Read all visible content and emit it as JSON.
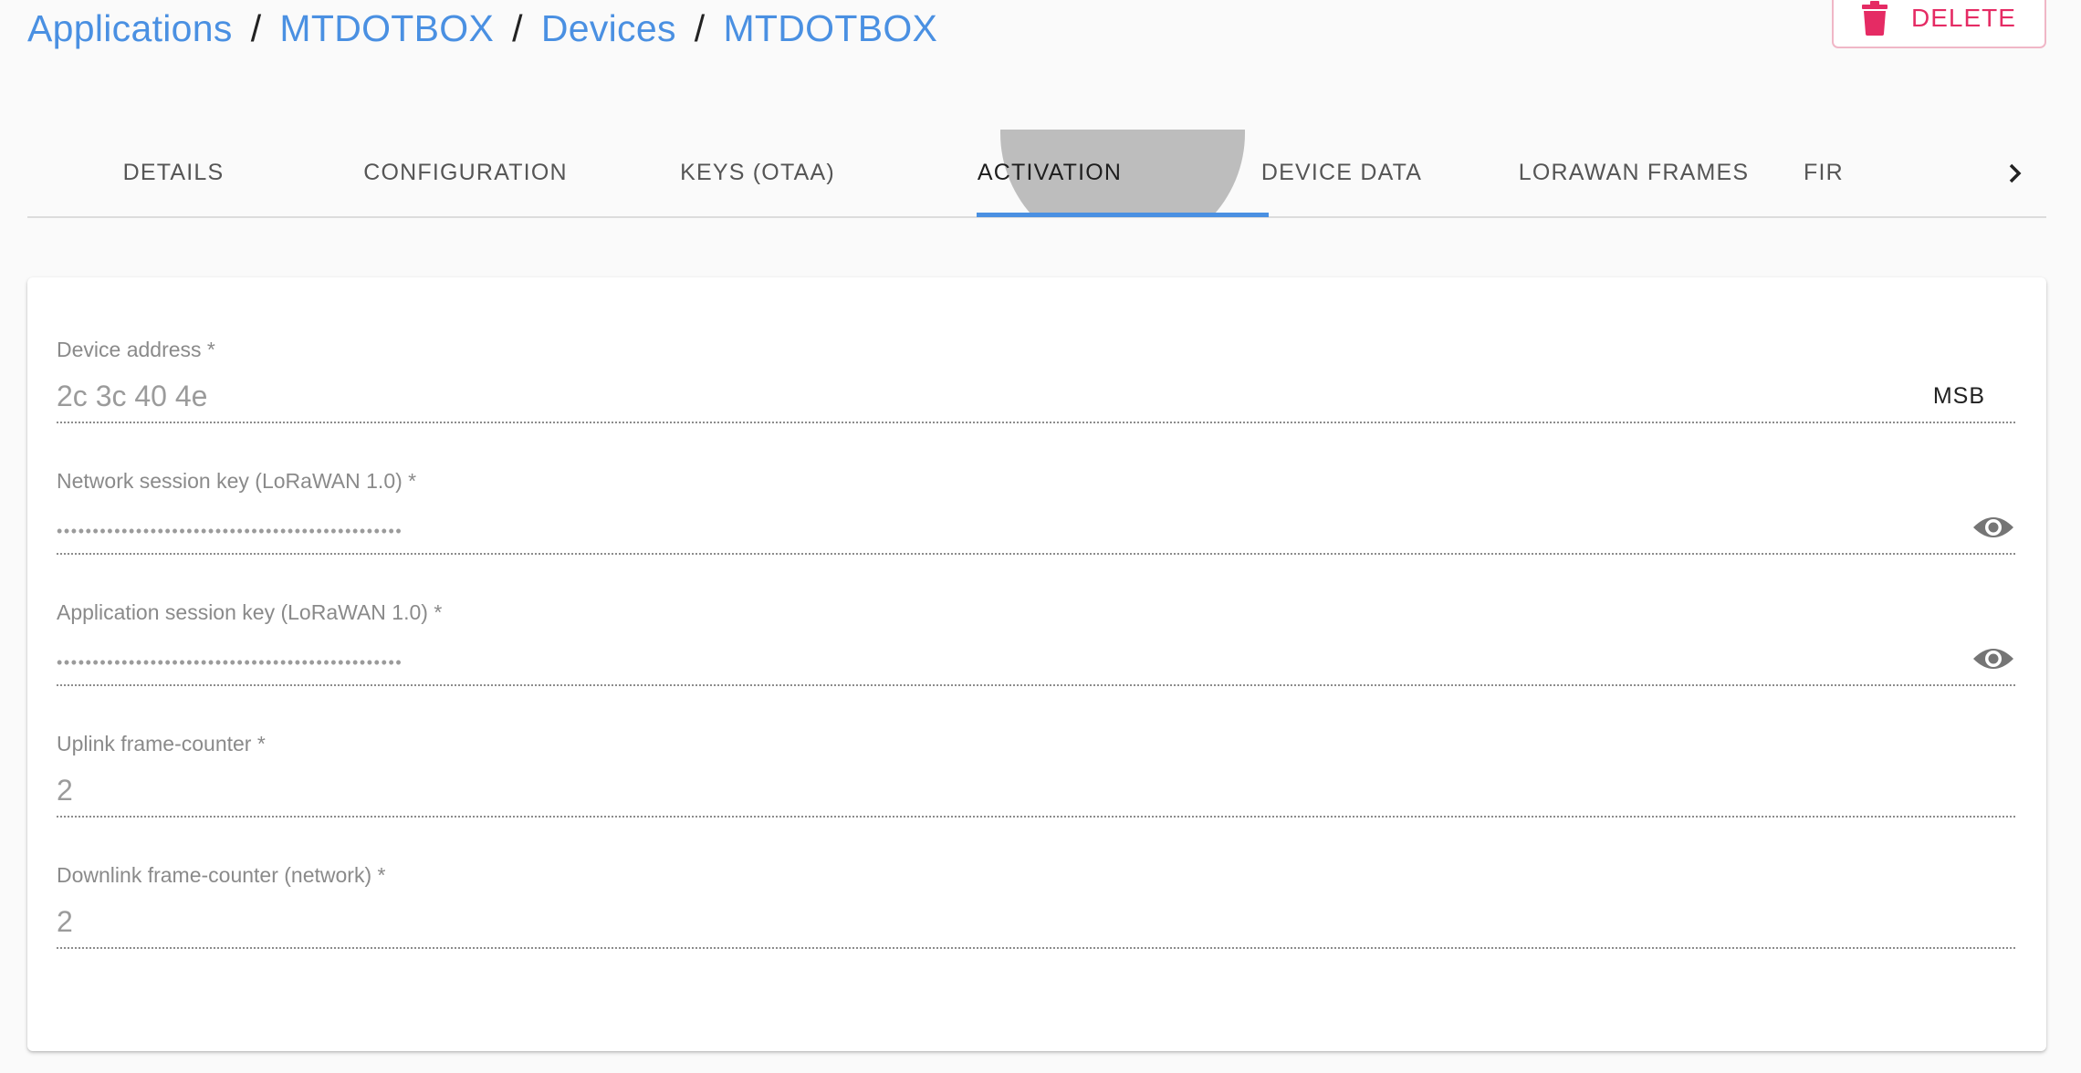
{
  "breadcrumb": [
    {
      "label": "Applications"
    },
    {
      "label": "MTDOTBOX"
    },
    {
      "label": "Devices"
    },
    {
      "label": "MTDOTBOX"
    }
  ],
  "delete_button": {
    "label": "DELETE"
  },
  "tabs": [
    {
      "label": "DETAILS"
    },
    {
      "label": "CONFIGURATION"
    },
    {
      "label": "KEYS (OTAA)"
    },
    {
      "label": "ACTIVATION"
    },
    {
      "label": "DEVICE DATA"
    },
    {
      "label": "LORAWAN FRAMES"
    },
    {
      "label": "FIR"
    }
  ],
  "active_tab": "ACTIVATION",
  "form": {
    "device_address": {
      "label": "Device address *",
      "value": "2c 3c 40 4e",
      "adornment": "MSB"
    },
    "nwk_s_key": {
      "label": "Network session key (LoRaWAN 1.0) *",
      "value": "••••••••••••••••••••••••••••••••••••••••••••••••"
    },
    "app_s_key": {
      "label": "Application session key (LoRaWAN 1.0) *",
      "value": "••••••••••••••••••••••••••••••••••••••••••••••••"
    },
    "f_cnt_up": {
      "label": "Uplink frame-counter *",
      "value": "2"
    },
    "n_f_cnt_down": {
      "label": "Downlink frame-counter (network) *",
      "value": "2"
    }
  },
  "colors": {
    "link": "#4a90e2",
    "danger": "#e52b64",
    "indicator": "#4a90e2"
  },
  "icons": {
    "delete": "trash-icon",
    "reveal": "eye-icon",
    "scroll_next": "chevron-right-icon"
  }
}
